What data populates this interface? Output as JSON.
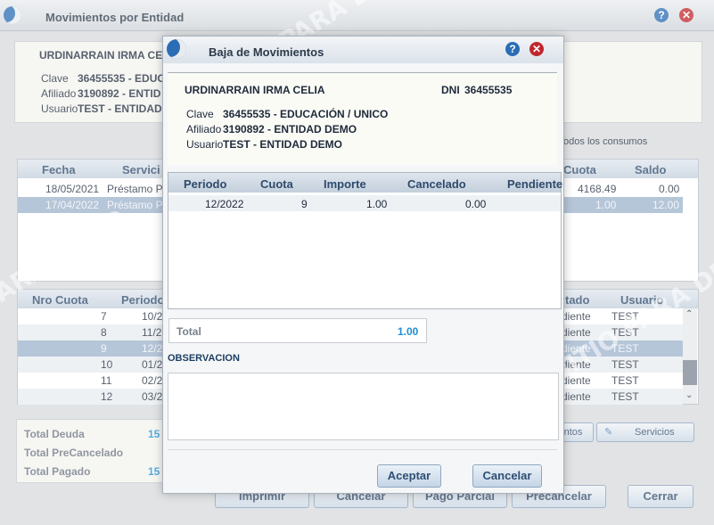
{
  "main_window": {
    "title": "Movimientos por Entidad",
    "header": {
      "name": "URDINARRAIN IRMA CELIA",
      "clave_label": "Clave",
      "clave_value": "36455535 - EDUC",
      "afiliado_label": "Afiliado",
      "afiliado_value": "3190892 - ENTID",
      "usuario_label": "Usuario",
      "usuario_value": "TEST - ENTIDAD"
    },
    "todos_consumos": "todos los consumos",
    "top_grid": {
      "columns": [
        "Fecha",
        "Servici",
        "Cuota",
        "Saldo"
      ],
      "rows": [
        {
          "fecha": "18/05/2021",
          "servicio": "Préstamo P",
          "cuota": "4168.49",
          "saldo": "0.00"
        },
        {
          "fecha": "17/04/2022",
          "servicio": "Préstamo P",
          "cuota": "1.00",
          "saldo": "12.00"
        }
      ]
    },
    "bottom_grid": {
      "columns": [
        "Nro Cuota",
        "Periodo",
        "tado",
        "Usuario"
      ],
      "rows": [
        {
          "nro": "7",
          "periodo": "10/2",
          "estado": "diente",
          "usuario": "TEST"
        },
        {
          "nro": "8",
          "periodo": "11/2",
          "estado": "diente",
          "usuario": "TEST"
        },
        {
          "nro": "9",
          "periodo": "12/2",
          "estado": "diente",
          "usuario": "TEST"
        },
        {
          "nro": "10",
          "periodo": "01/2",
          "estado": "diente",
          "usuario": "TEST"
        },
        {
          "nro": "11",
          "periodo": "02/2",
          "estado": "diente",
          "usuario": "TEST"
        },
        {
          "nro": "12",
          "periodo": "03/2",
          "estado": "diente",
          "usuario": "TEST"
        }
      ]
    },
    "totals": {
      "deuda_label": "Total Deuda",
      "deuda_value": "15",
      "precancelado_label": "Total PreCancelado",
      "pagado_label": "Total Pagado",
      "pagado_value": "15"
    },
    "buttons": {
      "movimientos": "ntos",
      "servicios": "Servicios",
      "imprimir": "Imprimir",
      "cancelar": "Cancelar",
      "pago_parcial": "Pago Parcial",
      "precancelar": "Precancelar",
      "cerrar": "Cerrar"
    },
    "watermark": "SITIO PARA DEMO"
  },
  "modal": {
    "title": "Baja de Movimientos",
    "name": "URDINARRAIN IRMA CELIA",
    "dni_label": "DNI",
    "dni_value": "36455535",
    "clave_label": "Clave",
    "clave_value": "36455535 - EDUCACIÓN / UNICO",
    "afiliado_label": "Afiliado",
    "afiliado_value": "3190892 - ENTIDAD DEMO",
    "usuario_label": "Usuario",
    "usuario_value": "TEST - ENTIDAD DEMO",
    "grid": {
      "columns": [
        "Periodo",
        "Cuota",
        "Importe",
        "Cancelado",
        "Pendiente"
      ],
      "rows": [
        {
          "periodo": "12/2022",
          "cuota": "9",
          "importe": "1.00",
          "cancelado": "0.00",
          "pendiente": ""
        }
      ]
    },
    "total_label": "Total",
    "total_value": "1.00",
    "observacion_label": "OBSERVACION",
    "observacion_value": "",
    "aceptar": "Aceptar",
    "cancelar": "Cancelar"
  },
  "colors": {
    "accent": "#2a6db5",
    "close": "#c0272d",
    "selected_row": "#9eb3cd",
    "total_value": "#1f8fd0"
  }
}
